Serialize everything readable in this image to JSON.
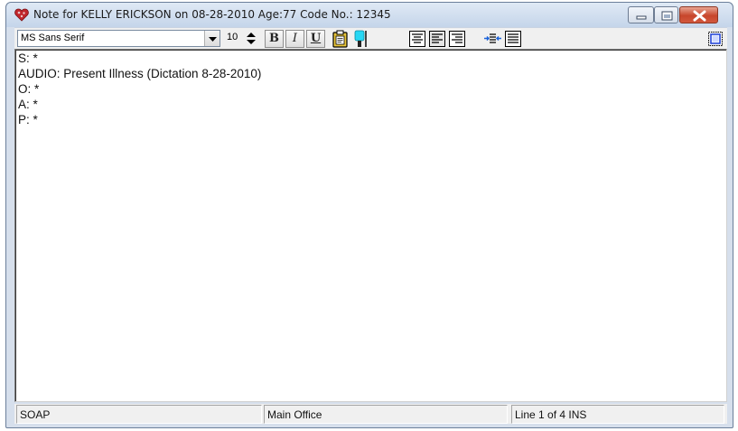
{
  "window": {
    "title": "Note for KELLY ERICKSON on 08-28-2010 Age:77  Code No.: 12345",
    "icon": "heart-icon",
    "controls": {
      "minimize": "minimize-icon",
      "maximize": "maximize-icon",
      "close": "close-icon"
    }
  },
  "toolbar": {
    "font_name": "MS Sans Serif",
    "font_size": "10",
    "bold_label": "B",
    "italic_label": "I",
    "underline_label": "U",
    "icons": [
      "clipboard-icon",
      "highlighter-icon",
      "align-center-icon",
      "align-left-icon",
      "align-right-icon",
      "indent-icon",
      "justify-icon",
      "fullscreen-icon"
    ]
  },
  "editor": {
    "lines": [
      "S: *",
      "AUDIO: Present Illness  (Dictation 8-28-2010)",
      "O: *",
      "A: *",
      "P: *"
    ]
  },
  "status": {
    "template": "SOAP",
    "office": "Main Office",
    "position": "Line 1 of 4   INS"
  },
  "colors": {
    "title_bg": "#c5d5ea",
    "close_button": "#c7462c",
    "editor_bg": "#ffffff"
  }
}
